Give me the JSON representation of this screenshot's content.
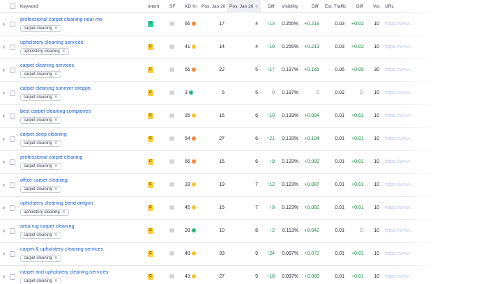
{
  "headers": {
    "keyword": "Keyword",
    "intent": "Intent",
    "sf": "SF",
    "kd": "KD %",
    "pos_jan20": "Pos. Jan 20",
    "pos_jan26": "Pos. Jan 26",
    "diff": "Diff",
    "visibility": "Visibility",
    "diff2": "Diff",
    "traffic": "Est. Traffic",
    "diff3": "Diff",
    "vol": "Vol.",
    "url": "URL"
  },
  "colors": {
    "kd_easy": "#2ab77a",
    "kd_possible": "#f4c431",
    "kd_difficult": "#f28a3b",
    "intent_T_bg": "#2ed19a",
    "intent_C_bg": "#f7cc3e",
    "positive": "#1d8a43",
    "link": "#1a5fd4"
  },
  "rows": [
    {
      "keyword": "professional carpet cleaning near me",
      "tag": "carpet cleaning",
      "intent": "T",
      "kd": "66",
      "kd_level": "difficult",
      "pos20": "17",
      "pos26": "4",
      "diff": "13",
      "diff_dir": "up",
      "vis": "0.255%",
      "vis_diff": "+0.218",
      "traffic": "0.03",
      "traffic_diff": "+0.02",
      "vol": "10",
      "url": "https://www..."
    },
    {
      "keyword": "upholstery cleaning services",
      "tag": "upholstery cleaning",
      "intent": "C",
      "kd": "41",
      "kd_level": "possible",
      "pos20": "14",
      "pos26": "4",
      "diff": "10",
      "diff_dir": "up",
      "vis": "0.255%",
      "vis_diff": "+0.213",
      "traffic": "0.03",
      "traffic_diff": "+0.02",
      "vol": "10",
      "url": "https://www..."
    },
    {
      "keyword": "carpet cleaning services",
      "tag": "carpet cleaning",
      "intent": "C",
      "kd": "55",
      "kd_level": "difficult",
      "pos20": "22",
      "pos26": "5",
      "diff": "17",
      "diff_dir": "up",
      "vis": "0.197%",
      "vis_diff": "+0.165",
      "traffic": "0.06",
      "traffic_diff": "+0.05",
      "vol": "30",
      "url": "https://www..."
    },
    {
      "keyword": "carpet cleaning sunriver oregon",
      "tag": "carpet cleaning",
      "intent": "C",
      "kd": "3",
      "kd_level": "easy",
      "pos20": "5",
      "pos26": "5",
      "diff": "0",
      "diff_dir": "none",
      "vis": "0.197%",
      "vis_diff": "0",
      "traffic": "0.02",
      "traffic_diff": "0",
      "vol": "10",
      "url": "https://www..."
    },
    {
      "keyword": "best carpet cleaning companies",
      "tag": "carpet cleaning",
      "intent": "C",
      "kd": "35",
      "kd_level": "possible",
      "pos20": "16",
      "pos26": "6",
      "diff": "10",
      "diff_dir": "up",
      "vis": "0.133%",
      "vis_diff": "+0.094",
      "traffic": "0.01",
      "traffic_diff": "+0.01",
      "vol": "10",
      "url": "https://www..."
    },
    {
      "keyword": "carpet deep cleaning",
      "tag": "carpet cleaning",
      "intent": "C",
      "kd": "54",
      "kd_level": "difficult",
      "pos20": "27",
      "pos26": "6",
      "diff": "21",
      "diff_dir": "up",
      "vis": "0.133%",
      "vis_diff": "+0.104",
      "traffic": "0.01",
      "traffic_diff": "+0.01",
      "vol": "10",
      "url": "https://www..."
    },
    {
      "keyword": "professional carpet cleaning",
      "tag": "carpet cleaning",
      "intent": "C",
      "kd": "66",
      "kd_level": "difficult",
      "pos20": "15",
      "pos26": "6",
      "diff": "9",
      "diff_dir": "up",
      "vis": "0.133%",
      "vis_diff": "+0.092",
      "traffic": "0.01",
      "traffic_diff": "+0.01",
      "vol": "10",
      "url": "https://www..."
    },
    {
      "keyword": "office carpet cleaning",
      "tag": "carpet cleaning",
      "intent": "C",
      "kd": "33",
      "kd_level": "possible",
      "pos20": "19",
      "pos26": "7",
      "diff": "12",
      "diff_dir": "up",
      "vis": "0.123%",
      "vis_diff": "+0.087",
      "traffic": "0.01",
      "traffic_diff": "+0.01",
      "vol": "10",
      "url": "https://www..."
    },
    {
      "keyword": "upholstery cleaning bend oregon",
      "tag": "upholstery cleaning",
      "intent": "C",
      "kd": "45",
      "kd_level": "possible",
      "pos20": "15",
      "pos26": "7",
      "diff": "8",
      "diff_dir": "up",
      "vis": "0.123%",
      "vis_diff": "+0.082",
      "traffic": "0.01",
      "traffic_diff": "+0.01",
      "vol": "10",
      "url": "https://www..."
    },
    {
      "keyword": "area rug carpet cleaning",
      "tag": "carpet cleaning",
      "intent": "C",
      "kd": "28",
      "kd_level": "easy",
      "pos20": "10",
      "pos26": "8",
      "diff": "2",
      "diff_dir": "up",
      "vis": "0.113%",
      "vis_diff": "+0.042",
      "traffic": "0.01",
      "traffic_diff": "0",
      "vol": "10",
      "url": "https://www..."
    },
    {
      "keyword": "carpet & upholstery cleaning services",
      "tag": "carpet cleaning",
      "intent": "C",
      "kd": "49",
      "kd_level": "possible",
      "pos20": "33",
      "pos26": "9",
      "diff": "24",
      "diff_dir": "up",
      "vis": "0.097%",
      "vis_diff": "+0.072",
      "traffic": "0.01",
      "traffic_diff": "+0.01",
      "vol": "10",
      "url": "https://www..."
    },
    {
      "keyword": "carpet and upholstery cleaning services",
      "tag": "carpet cleaning",
      "intent": "C",
      "kd": "43",
      "kd_level": "possible",
      "pos20": "27",
      "pos26": "9",
      "diff": "18",
      "diff_dir": "up",
      "vis": "0.097%",
      "vis_diff": "+0.069",
      "traffic": "0.01",
      "traffic_diff": "+0.01",
      "vol": "10",
      "url": "https://www..."
    }
  ]
}
